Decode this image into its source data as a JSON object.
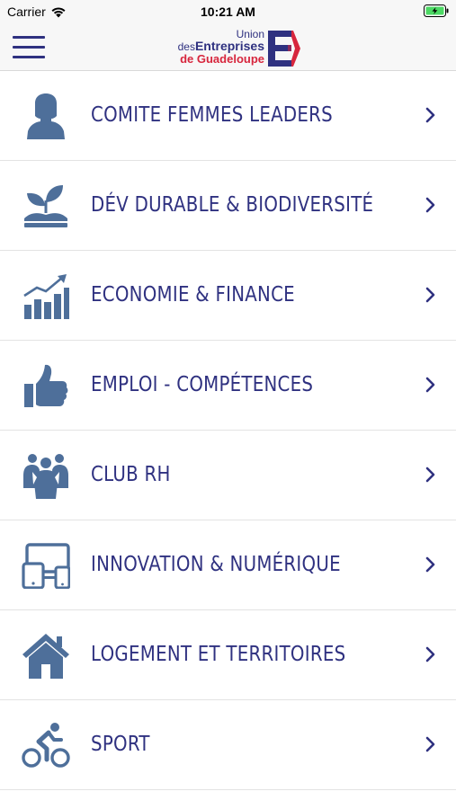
{
  "status_bar": {
    "carrier": "Carrier",
    "time": "10:21 AM",
    "wifi_icon": "wifi-icon",
    "battery_icon": "battery-charging-icon"
  },
  "header": {
    "menu_icon": "hamburger-menu-icon",
    "logo": {
      "line1": "Union",
      "line2_prefix": "des",
      "line2_main": "Entreprises",
      "line3": "de Guadeloupe"
    }
  },
  "colors": {
    "accent": "#2f3180",
    "icon": "#4e6f9a",
    "brand_red": "#d7263d"
  },
  "menu_items": [
    {
      "label": "COMITE FEMMES LEADERS",
      "icon": "woman-icon"
    },
    {
      "label": "DÉV DURABLE & BIODIVERSITÉ",
      "icon": "plant-icon"
    },
    {
      "label": "ECONOMIE & FINANCE",
      "icon": "growth-chart-icon"
    },
    {
      "label": "EMPLOI - COMPÉTENCES",
      "icon": "thumbs-up-icon"
    },
    {
      "label": "CLUB RH",
      "icon": "people-group-icon"
    },
    {
      "label": "INNOVATION & NUMÉRIQUE",
      "icon": "devices-icon"
    },
    {
      "label": "LOGEMENT ET TERRITOIRES",
      "icon": "house-icon"
    },
    {
      "label": "SPORT",
      "icon": "cyclist-icon"
    }
  ]
}
